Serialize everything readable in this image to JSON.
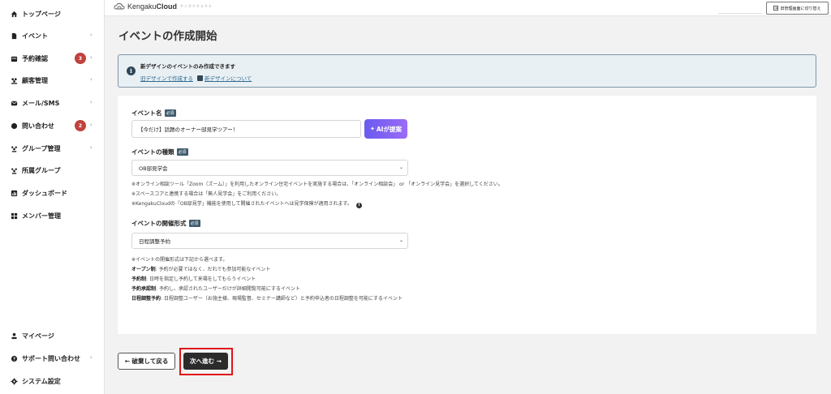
{
  "sidebar": {
    "items": [
      {
        "label": "トップページ",
        "icon": "home-icon"
      },
      {
        "label": "イベント",
        "icon": "document-icon",
        "chevron": "›"
      },
      {
        "label": "予約確認",
        "icon": "calendar-icon",
        "badge": "3",
        "chevron": "›"
      },
      {
        "label": "顧客管理",
        "icon": "users-icon",
        "chevron": "›"
      },
      {
        "label": "メール/SMS",
        "icon": "mail-icon",
        "chevron": "›"
      },
      {
        "label": "問い合わせ",
        "icon": "chat-icon",
        "badge": "2",
        "chevron": "›"
      },
      {
        "label": "グループ管理",
        "icon": "group-icon",
        "chevron": "›"
      },
      {
        "label": "所属グループ",
        "icon": "group-icon"
      },
      {
        "label": "ダッシュボード",
        "icon": "chart-icon"
      },
      {
        "label": "メンバー管理",
        "icon": "grid-icon"
      }
    ],
    "bottom_items": [
      {
        "label": "マイページ",
        "icon": "user-icon"
      },
      {
        "label": "サポート問い合わせ",
        "icon": "help-icon",
        "chevron": "›"
      },
      {
        "label": "システム設定",
        "icon": "gear-icon"
      }
    ]
  },
  "topbar": {
    "brand_light": "Kengaku",
    "brand_bold": "Cloud",
    "tagline": "ケンガククラウド",
    "switch_label": "旧管理画面に切り替え"
  },
  "page": {
    "title": "イベントの作成開始"
  },
  "notice": {
    "title": "新デザインのイベントのみ作成できます",
    "link_old": "旧デザインで作成する",
    "link_new": "新デザインについて"
  },
  "form": {
    "required_label": "必須",
    "event_name": {
      "label": "イベント名",
      "value": "【今だけ】話題のオーナー邸見学ツアー！",
      "ai_button": "AIが提案"
    },
    "event_type": {
      "label": "イベントの種類",
      "selected": "OB邸見学会",
      "notes": [
        "※オンライン相談ツール「Zoom（ズーム）」を利用したオンライン住宅イベントを実施する場合は、「オンライン相談会」 or 「オンライン見学会」を選択してください。",
        "※スペースコアと連携する場合は「無人見学会」をご利用ください。",
        "※KengakuCloudの「OB邸見学」機能を使用して開催されたイベントへは見学保険が適用されます。"
      ]
    },
    "event_format": {
      "label": "イベントの開催形式",
      "selected": "日程調整予約",
      "intro": "※イベントの開催形式は下記から選べます。",
      "options": [
        {
          "name": "オープン制",
          "desc": ": 予約が必要ではなく、だれでも参加可能なイベント"
        },
        {
          "name": "予約制",
          "desc": ": 日時を指定し予約して来場をしてもらうイベント"
        },
        {
          "name": "予約承認制",
          "desc": ": 予約し、承認されたユーザーだけが詳細閲覧可能にするイベント"
        },
        {
          "name": "日程調整予約",
          "desc": ": 日程調整ユーザー（お施主様、現場監督、セミナー講師など）と予約申込者の日程調整を可能にするイベント"
        }
      ]
    }
  },
  "footer": {
    "back_label": "← 破棄して戻る",
    "next_label": "次へ進む →"
  },
  "colors": {
    "badge": "#c0423d",
    "highlight": "#e0141a",
    "primary_dark": "#2b2b2b",
    "ai_gradient_start": "#6a5bf0",
    "ai_gradient_end": "#9b6bf5"
  }
}
